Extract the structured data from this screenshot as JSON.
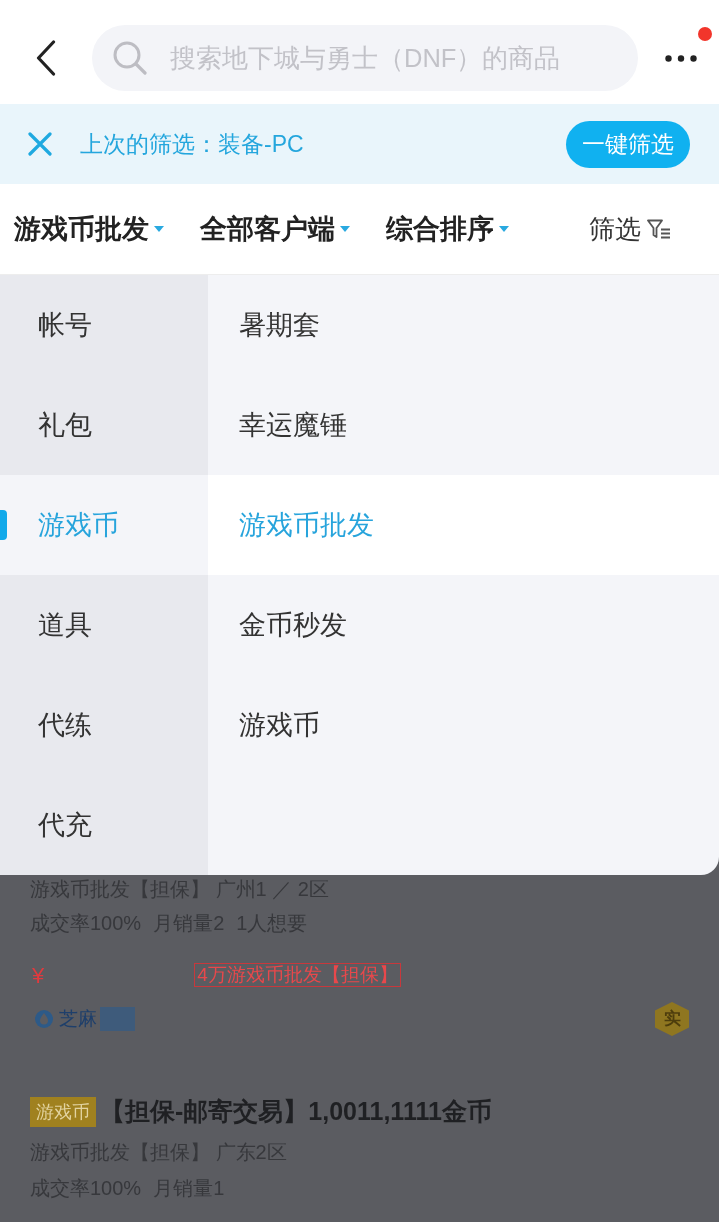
{
  "header": {
    "search": {
      "placeholder": "搜索地下城与勇士（DNF）的商品"
    },
    "more_menu": {
      "notification": true
    }
  },
  "last_filter": {
    "text": "上次的筛选：装备-PC",
    "button": "一键筛选"
  },
  "sort_tabs": [
    {
      "label": "游戏币批发",
      "kind": "dropdown"
    },
    {
      "label": "全部客户端",
      "kind": "dropdown"
    },
    {
      "label": "综合排序",
      "kind": "dropdown"
    },
    {
      "label": "筛选",
      "kind": "filter"
    }
  ],
  "category_menu": {
    "categories": [
      {
        "label": "帐号",
        "selected": false
      },
      {
        "label": "礼包",
        "selected": false
      },
      {
        "label": "游戏币",
        "selected": true
      },
      {
        "label": "道具",
        "selected": false
      },
      {
        "label": "代练",
        "selected": false
      },
      {
        "label": "代充",
        "selected": false
      }
    ],
    "subcategories": [
      {
        "label": "暑期套",
        "selected": false
      },
      {
        "label": "幸运魔锤",
        "selected": false
      },
      {
        "label": "游戏币批发",
        "selected": true
      },
      {
        "label": "金币秒发",
        "selected": false
      },
      {
        "label": "游戏币",
        "selected": false
      }
    ]
  },
  "listings": [
    {
      "subtitle": "游戏币批发【担保】 广州1 ／ 2区",
      "stats": [
        "成交率100%",
        "月销量2",
        "1人想要"
      ],
      "price_symbol": "¥",
      "highlight": "4万游戏币批发【担保】",
      "credit": "芝麻",
      "credit_redacted": true,
      "badge": "实"
    },
    {
      "tag": "游戏币",
      "title": "【担保-邮寄交易】1,0011,1111金币",
      "subtitle": "游戏币批发【担保】 广东2区",
      "stats": [
        "成交率100%",
        "月销量1"
      ]
    }
  ]
}
